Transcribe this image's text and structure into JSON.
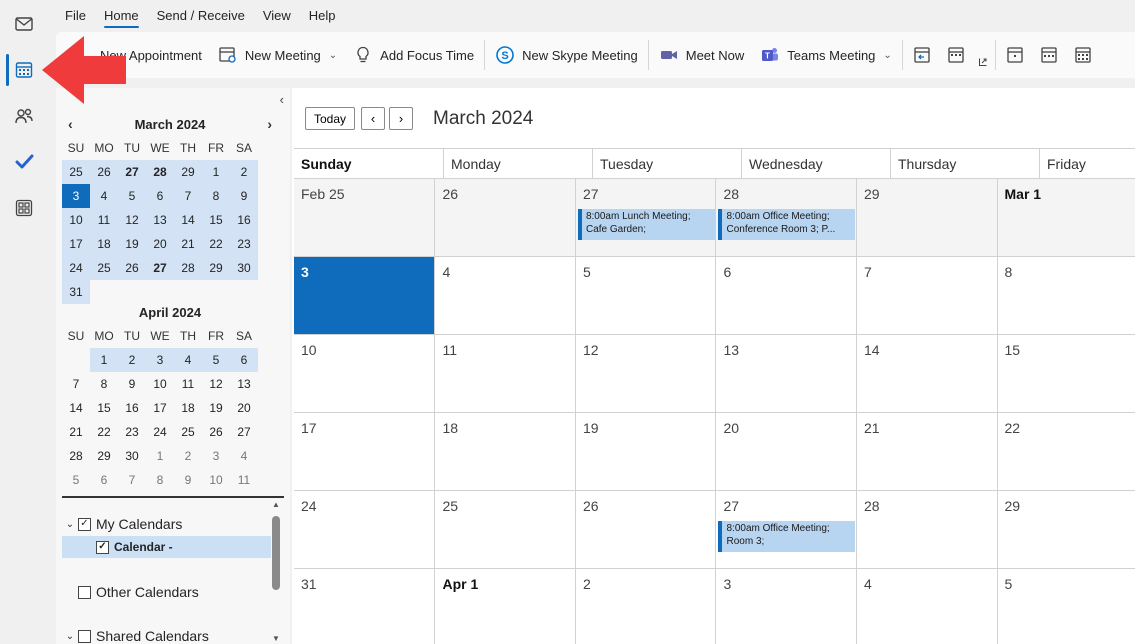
{
  "menu": {
    "file": "File",
    "home": "Home",
    "send_receive": "Send / Receive",
    "view": "View",
    "help": "Help"
  },
  "ribbon": {
    "new_appointment": "New Appointment",
    "new_meeting": "New Meeting",
    "add_focus_time": "Add Focus Time",
    "new_skype_meeting": "New Skype Meeting",
    "meet_now": "Meet Now",
    "teams_meeting": "Teams Meeting"
  },
  "mini_calendar_march": {
    "title": "March 2024",
    "dow": [
      "SU",
      "MO",
      "TU",
      "WE",
      "TH",
      "FR",
      "SA"
    ],
    "weeks": [
      [
        "25",
        "26",
        "27",
        "28",
        "29",
        "1",
        "2"
      ],
      [
        "3",
        "4",
        "5",
        "6",
        "7",
        "8",
        "9"
      ],
      [
        "10",
        "11",
        "12",
        "13",
        "14",
        "15",
        "16"
      ],
      [
        "17",
        "18",
        "19",
        "20",
        "21",
        "22",
        "23"
      ],
      [
        "24",
        "25",
        "26",
        "27",
        "28",
        "29",
        "30"
      ],
      [
        "31",
        "",
        "",
        "",
        "",
        "",
        ""
      ]
    ]
  },
  "mini_calendar_april": {
    "title": "April 2024",
    "dow": [
      "SU",
      "MO",
      "TU",
      "WE",
      "TH",
      "FR",
      "SA"
    ],
    "weeks": [
      [
        "",
        "1",
        "2",
        "3",
        "4",
        "5",
        "6"
      ],
      [
        "7",
        "8",
        "9",
        "10",
        "11",
        "12",
        "13"
      ],
      [
        "14",
        "15",
        "16",
        "17",
        "18",
        "19",
        "20"
      ],
      [
        "21",
        "22",
        "23",
        "24",
        "25",
        "26",
        "27"
      ],
      [
        "28",
        "29",
        "30",
        "1",
        "2",
        "3",
        "4"
      ],
      [
        "5",
        "6",
        "7",
        "8",
        "9",
        "10",
        "11"
      ]
    ]
  },
  "folders": {
    "my_calendars": "My Calendars",
    "calendar": "Calendar -",
    "other_calendars": "Other Calendars",
    "shared_calendars": "Shared Calendars"
  },
  "main": {
    "today_button": "Today",
    "prev": "‹",
    "next": "›",
    "month_title": "March 2024",
    "days_of_week": [
      "Sunday",
      "Monday",
      "Tuesday",
      "Wednesday",
      "Thursday",
      "Friday"
    ],
    "weeks": [
      [
        "Feb 25",
        "26",
        "27",
        "28",
        "29",
        "Mar 1"
      ],
      [
        "3",
        "4",
        "5",
        "6",
        "7",
        "8"
      ],
      [
        "10",
        "11",
        "12",
        "13",
        "14",
        "15"
      ],
      [
        "17",
        "18",
        "19",
        "20",
        "21",
        "22"
      ],
      [
        "24",
        "25",
        "26",
        "27",
        "28",
        "29"
      ],
      [
        "31",
        "Apr 1",
        "2",
        "3",
        "4",
        "5"
      ]
    ],
    "events": {
      "lunch_meeting": "8:00am Lunch Meeting; Cafe Garden;",
      "office_meeting_28": "8:00am Office Meeting; Conference Room 3; P...",
      "office_meeting_27": "8:00am Office Meeting; Room 3;"
    }
  },
  "colors": {
    "accent": "#0f6cbd",
    "event_bg": "#b7d4f0",
    "mini_highlight": "#d3e3f5",
    "arrow": "#ef3b3b"
  }
}
